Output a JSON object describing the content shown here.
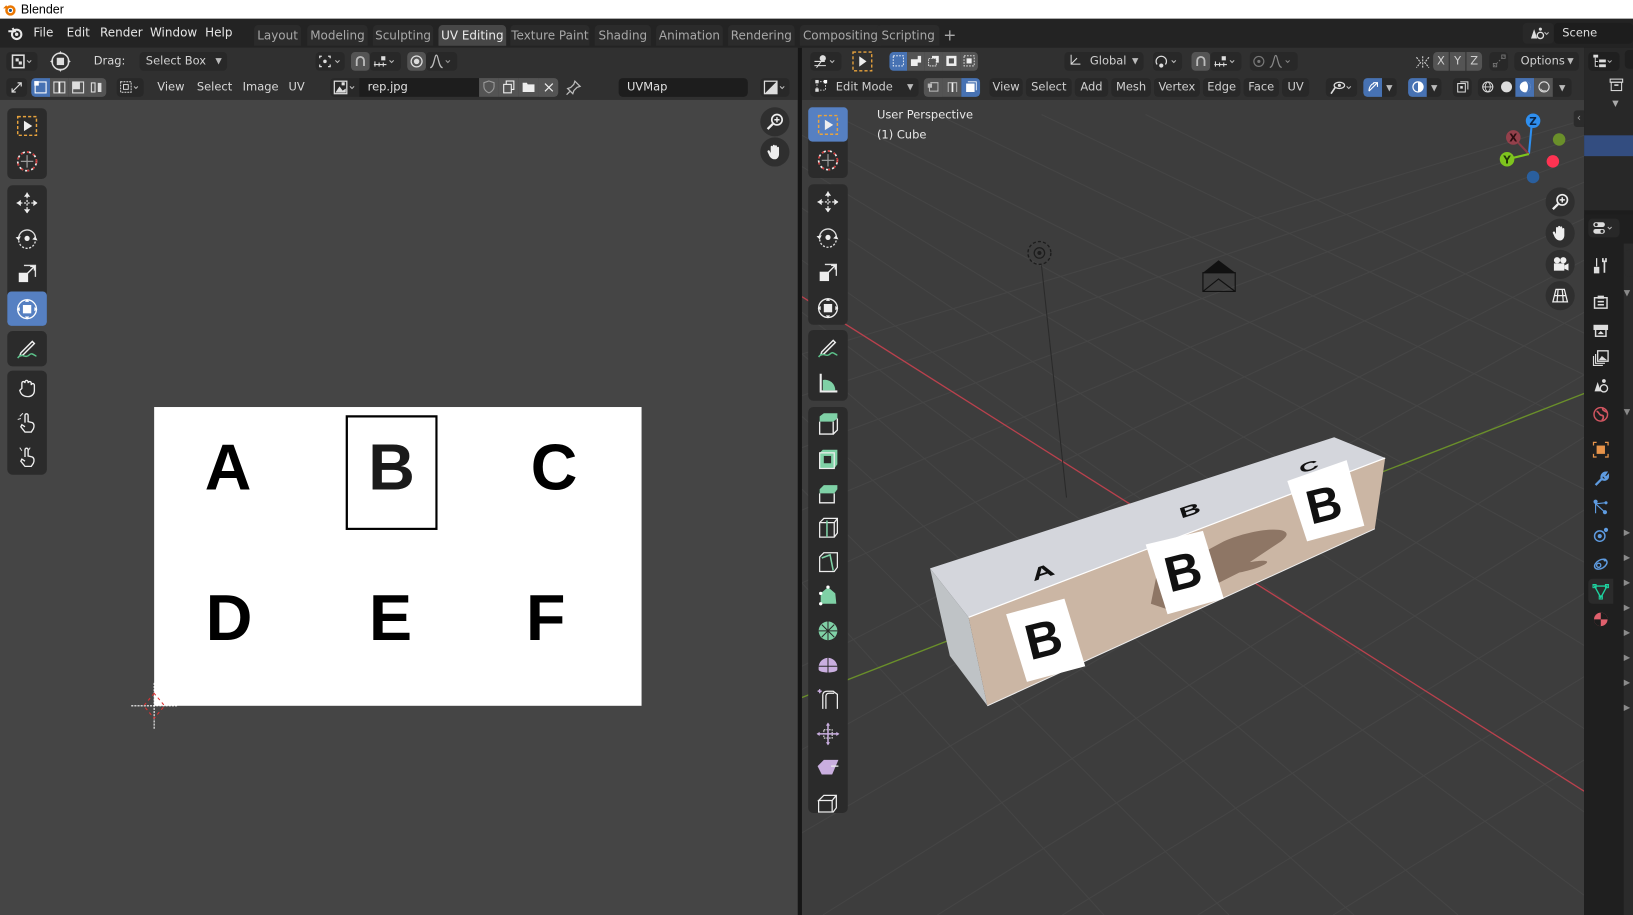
{
  "window": {
    "title": "Blender"
  },
  "menubar": {
    "menus": [
      "File",
      "Edit",
      "Render",
      "Window",
      "Help"
    ],
    "workspaces": [
      "Layout",
      "Modeling",
      "Sculpting",
      "UV Editing",
      "Texture Paint",
      "Shading",
      "Animation",
      "Rendering",
      "Compositing",
      "Scripting"
    ],
    "active_workspace": "UV Editing",
    "add_workspace": "+",
    "scene_name": "Scene"
  },
  "uv_editor": {
    "drag_label": "Drag:",
    "drag_mode": "Select Box",
    "menus": [
      "View",
      "Select",
      "Image",
      "UV"
    ],
    "image_name": "rep.jpg",
    "uv_map": "UVMap",
    "image_letters": [
      "A",
      "B",
      "C",
      "D",
      "E",
      "F"
    ],
    "selected_letter": "B"
  },
  "viewport": {
    "transform_orientation": "Global",
    "mode": "Edit Mode",
    "menus": [
      "View",
      "Select",
      "Add",
      "Mesh",
      "Vertex",
      "Edge",
      "Face",
      "UV"
    ],
    "axis_toggles": [
      "X",
      "Y",
      "Z"
    ],
    "options_label": "Options",
    "overlay_line1": "User Perspective",
    "overlay_line2": "(1) Cube",
    "gizmo_axes": {
      "x": "X",
      "y": "Y",
      "z": "Z"
    },
    "top_face_letters": [
      "A",
      "B",
      "C"
    ],
    "side_face_letter": "B",
    "colors": {
      "x_axis": "#c4414d",
      "y_axis": "#7ea42a",
      "z_axis": "#2e8ff0",
      "selection": "#4772b3",
      "active_tool": "#5680c2"
    }
  }
}
